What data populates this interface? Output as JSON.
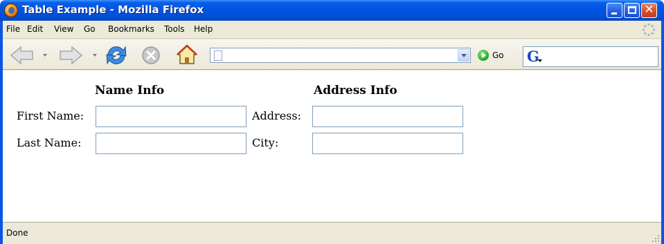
{
  "window": {
    "title": "Table Example - Mozilla Firefox"
  },
  "menu": {
    "items": [
      {
        "label": "File"
      },
      {
        "label": "Edit"
      },
      {
        "label": "View"
      },
      {
        "label": "Go"
      },
      {
        "label": "Bookmarks"
      },
      {
        "label": "Tools"
      },
      {
        "label": "Help"
      }
    ]
  },
  "toolbar": {
    "icons": [
      "back-arrow-icon",
      "forward-arrow-icon",
      "reload-icon",
      "stop-icon",
      "home-icon"
    ],
    "url_value": "",
    "go_label": "Go",
    "search_value": ""
  },
  "form": {
    "name_heading": "Name Info",
    "address_heading": "Address Info",
    "first_name_label": "First Name:",
    "last_name_label": "Last Name:",
    "address_label": "Address:",
    "city_label": "City:",
    "first_name_value": "",
    "last_name_value": "",
    "address_value": "",
    "city_value": ""
  },
  "status": {
    "text": "Done"
  },
  "colors": {
    "titlebar": "#0054e3",
    "chrome": "#ece9d8",
    "field_border": "#7f9db9"
  }
}
